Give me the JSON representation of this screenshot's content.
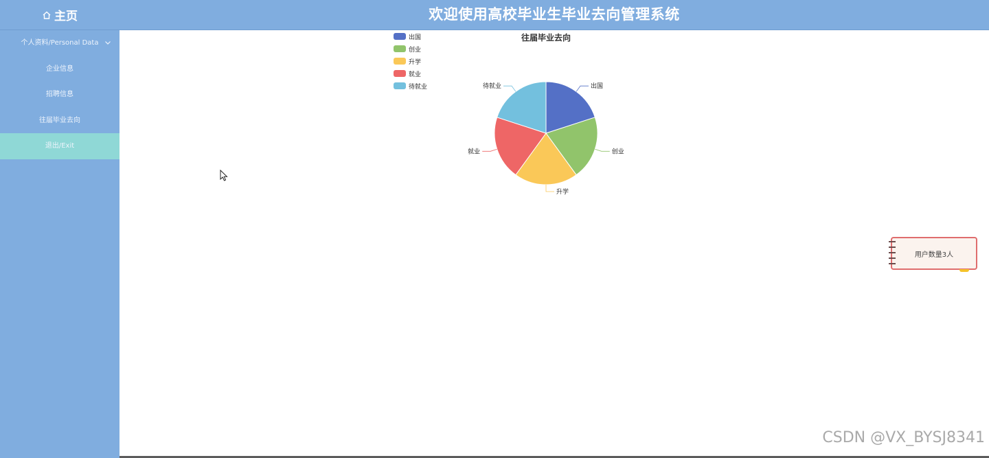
{
  "header": {
    "home_label": "主页",
    "home_icon": "home-icon",
    "system_title": "欢迎使用高校毕业生毕业去向管理系统"
  },
  "sidebar": {
    "items": [
      {
        "label": "个人资料/Personal Data",
        "icon": "chevron-down-icon"
      },
      {
        "label": "企业信息"
      },
      {
        "label": "招聘信息"
      },
      {
        "label": "往届毕业去向"
      },
      {
        "label": "退出/Exit",
        "active": true
      }
    ]
  },
  "colors": {
    "header_bg": "#80addf",
    "sidebar_bg": "#80addf",
    "active_item_bg": "#8fd8d6",
    "note_border": "#df6d6d"
  },
  "chart_data": {
    "type": "pie",
    "title": "往届毕业去向",
    "legend_position": "top-left",
    "categories": [
      "出国",
      "创业",
      "升学",
      "就业",
      "待就业"
    ],
    "values": [
      1,
      1,
      1,
      1,
      1
    ],
    "colors": [
      "#5470c6",
      "#91c46b",
      "#fac858",
      "#ee6666",
      "#73c0de"
    ]
  },
  "note": {
    "text": "用户数量3人"
  },
  "watermark": "CSDN @VX_BYSJ8341"
}
